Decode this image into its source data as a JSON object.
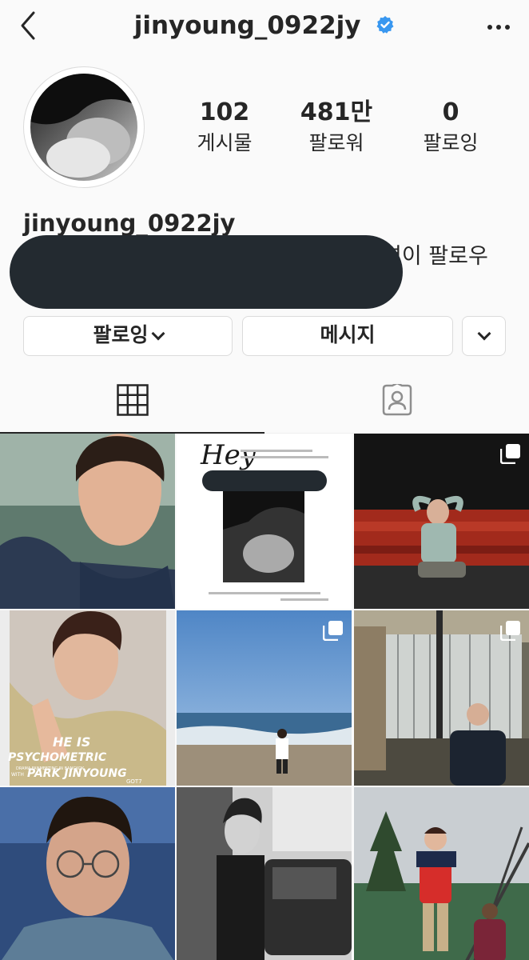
{
  "header": {
    "username": "jinyoung_0922jy",
    "icons": [
      "back-arrow-icon",
      "verified-badge-icon",
      "more-options-icon"
    ]
  },
  "stats": [
    {
      "value": "102",
      "label": "게시물"
    },
    {
      "value": "481만",
      "label": "팔로워"
    },
    {
      "value": "0",
      "label": "팔로잉"
    }
  ],
  "bio": {
    "name": "jinyoung_0922jy",
    "followed_by": "명이 팔로우"
  },
  "actions": {
    "following_label": "팔로잉",
    "message_label": "메시지"
  },
  "tabs": [
    "grid-icon",
    "tagged-icon"
  ],
  "posts": [
    {
      "desc": "selfie",
      "multi": false
    },
    {
      "desc": "Hey poster",
      "multi": false
    },
    {
      "desc": "concert heart",
      "multi": true
    },
    {
      "desc": "HE IS PSYCHOMETRIC",
      "multi": false,
      "text": [
        "HE IS",
        "PSYCHOMETRIC",
        "DRAMA FANMEETING IN BANGKOK",
        "WITH",
        "PARK JINYOUNG",
        "GOT7"
      ]
    },
    {
      "desc": "beach",
      "multi": true
    },
    {
      "desc": "waterfall",
      "multi": true
    },
    {
      "desc": "glasses selfie",
      "multi": false
    },
    {
      "desc": "black and white car",
      "multi": false
    },
    {
      "desc": "red jacket",
      "multi": false
    }
  ],
  "colors": {
    "verified": "#3897f0",
    "redaction": "#232a30",
    "border": "#dbdbdb"
  }
}
